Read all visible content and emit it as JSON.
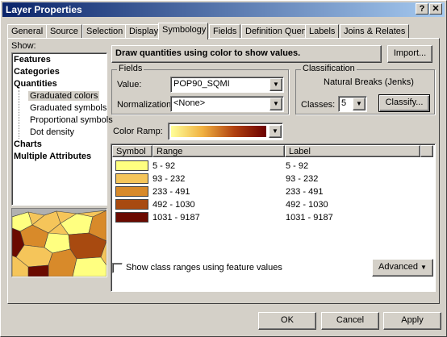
{
  "window": {
    "title": "Layer Properties",
    "help_btn": "?",
    "close_btn": "✕"
  },
  "tabs": [
    "General",
    "Source",
    "Selection",
    "Display",
    "Symbology",
    "Fields",
    "Definition Query",
    "Labels",
    "Joins & Relates"
  ],
  "show": {
    "label": "Show:",
    "items": [
      "Features",
      "Categories",
      "Quantities",
      "Graduated colors",
      "Graduated symbols",
      "Proportional symbols",
      "Dot density",
      "Charts",
      "Multiple Attributes"
    ]
  },
  "header": {
    "text": "Draw quantities using color to show values.",
    "import_label": "Import..."
  },
  "fields": {
    "label": "Fields",
    "value_label": "Value:",
    "value": "POP90_SQMI",
    "normalization_label": "Normalization:",
    "normalization": "<None>"
  },
  "classification": {
    "label": "Classification",
    "method": "Natural Breaks (Jenks)",
    "classes_label": "Classes:",
    "classes": "5",
    "classify_label": "Classify..."
  },
  "color_ramp": {
    "label": "Color Ramp:",
    "from": "#ffff99",
    "to": "#6b0000"
  },
  "legend": {
    "columns": [
      "Symbol",
      "Range",
      "Label"
    ],
    "rows": [
      {
        "color": "#ffff80",
        "range": "5 - 92",
        "label": "5 - 92"
      },
      {
        "color": "#f5c55a",
        "range": "93 - 232",
        "label": "93 - 232"
      },
      {
        "color": "#d88a2a",
        "range": "233 - 491",
        "label": "233 - 491"
      },
      {
        "color": "#a84a10",
        "range": "492 - 1030",
        "label": "492 - 1030"
      },
      {
        "color": "#6b0a00",
        "range": "1031 - 9187",
        "label": "1031 - 9187"
      }
    ]
  },
  "show_class_ranges_label": "Show class ranges using feature values",
  "advanced_label": "Advanced",
  "buttons": {
    "ok": "OK",
    "cancel": "Cancel",
    "apply": "Apply"
  }
}
